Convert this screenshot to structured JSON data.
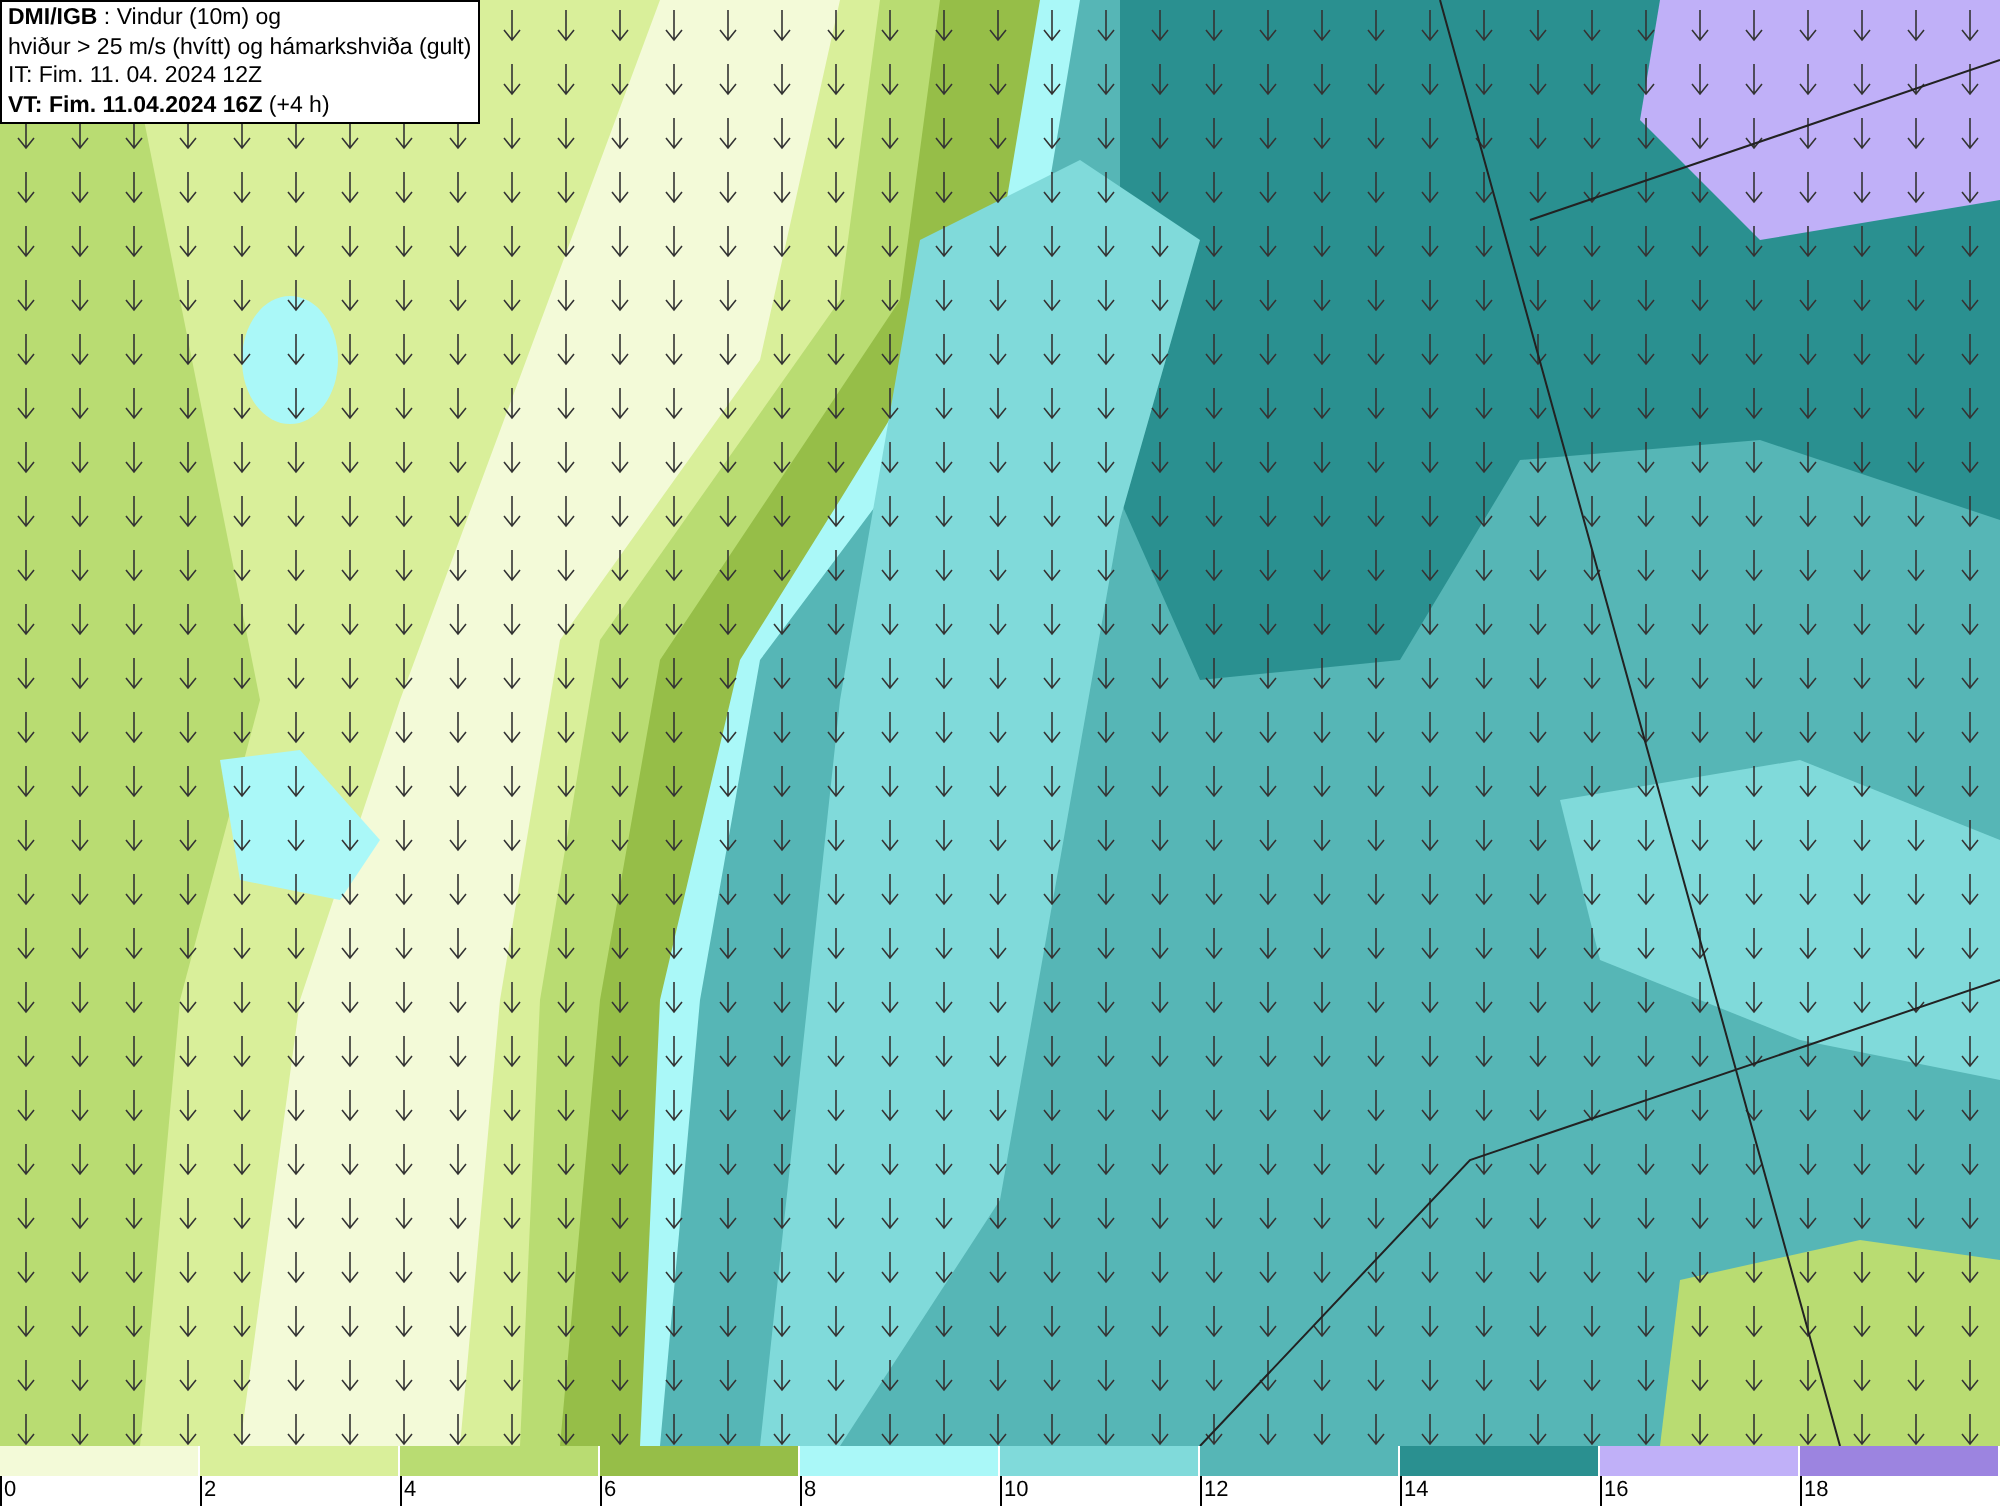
{
  "info_box": {
    "lines": [
      "**DMI/IGB** : Vindur (10m) og",
      "hviður > 25 m/s (hvítt) og hámarkshviða (gult)",
      "IT: Fim. 11. 04. 2024 12Z",
      "**VT: Fim. 11.04.2024 16Z** (+4 h)"
    ]
  },
  "legend": {
    "items": [
      {
        "label": "0",
        "color": "#f3fad8"
      },
      {
        "label": "2",
        "color": "#d9ef9a"
      },
      {
        "label": "4",
        "color": "#b9dc72"
      },
      {
        "label": "6",
        "color": "#96be48"
      },
      {
        "label": "8",
        "color": "#aaf8f8"
      },
      {
        "label": "10",
        "color": "#80dada"
      },
      {
        "label": "12",
        "color": "#56b6b6"
      },
      {
        "label": "14",
        "color": "#2a9090"
      },
      {
        "label": "16",
        "color": "#c0b0f8"
      },
      {
        "label": "18",
        "color": "#9c84e0"
      }
    ]
  }
}
